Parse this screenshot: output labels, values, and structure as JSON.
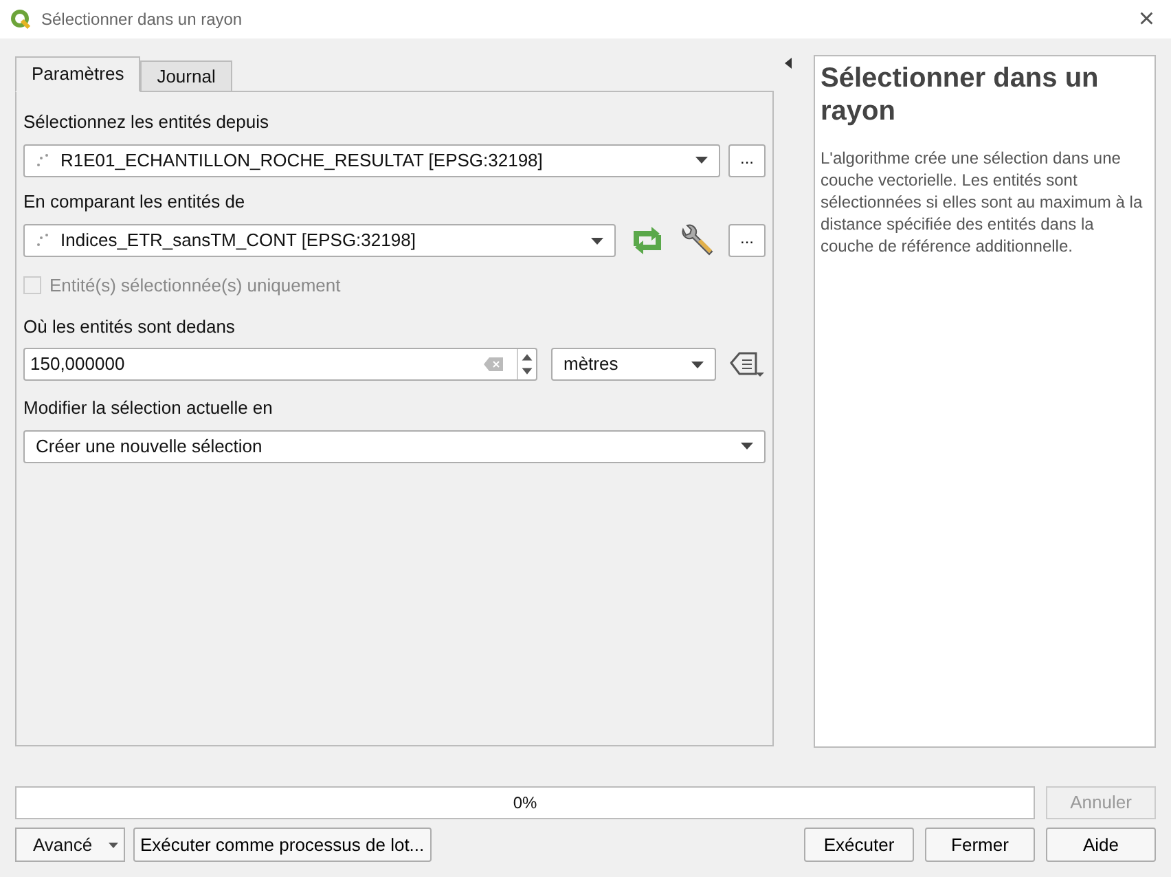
{
  "window": {
    "title": "Sélectionner dans un rayon",
    "close": "×"
  },
  "tabs": [
    {
      "label": "Paramètres",
      "selected": true
    },
    {
      "label": "Journal",
      "selected": false
    }
  ],
  "params": {
    "input_label": "Sélectionnez les entités depuis",
    "input_layer": "R1E01_ECHANTILLON_ROCHE_RESULTAT [EPSG:32198]",
    "input_more": "...",
    "compare_label": "En comparant les entités de",
    "compare_layer": "Indices_ETR_sansTM_CONT [EPSG:32198]",
    "compare_more": "...",
    "selected_only": {
      "label": "Entité(s) sélectionnée(s) uniquement",
      "checked": false,
      "disabled": true
    },
    "distance_label": "Où les entités sont dedans",
    "distance_value": "150,000000",
    "unit": "mètres",
    "method_label": "Modifier la sélection actuelle en",
    "method_value": "Créer une nouvelle sélection"
  },
  "help": {
    "title": "Sélectionner dans un rayon",
    "text": "L'algorithme crée une sélection dans une couche vectorielle. Les entités sont sélectionnées si elles sont au maximum à la distance spécifiée des entités dans la couche de référence additionnelle."
  },
  "progress": {
    "level": 0,
    "reading": "0%"
  },
  "buttons": {
    "cancel": {
      "label": "Annuler",
      "disabled": true
    },
    "advanced": "Avancé",
    "batch": "Exécuter comme processus de lot...",
    "run": "Exécuter",
    "close": "Fermer",
    "help": "Aide"
  }
}
